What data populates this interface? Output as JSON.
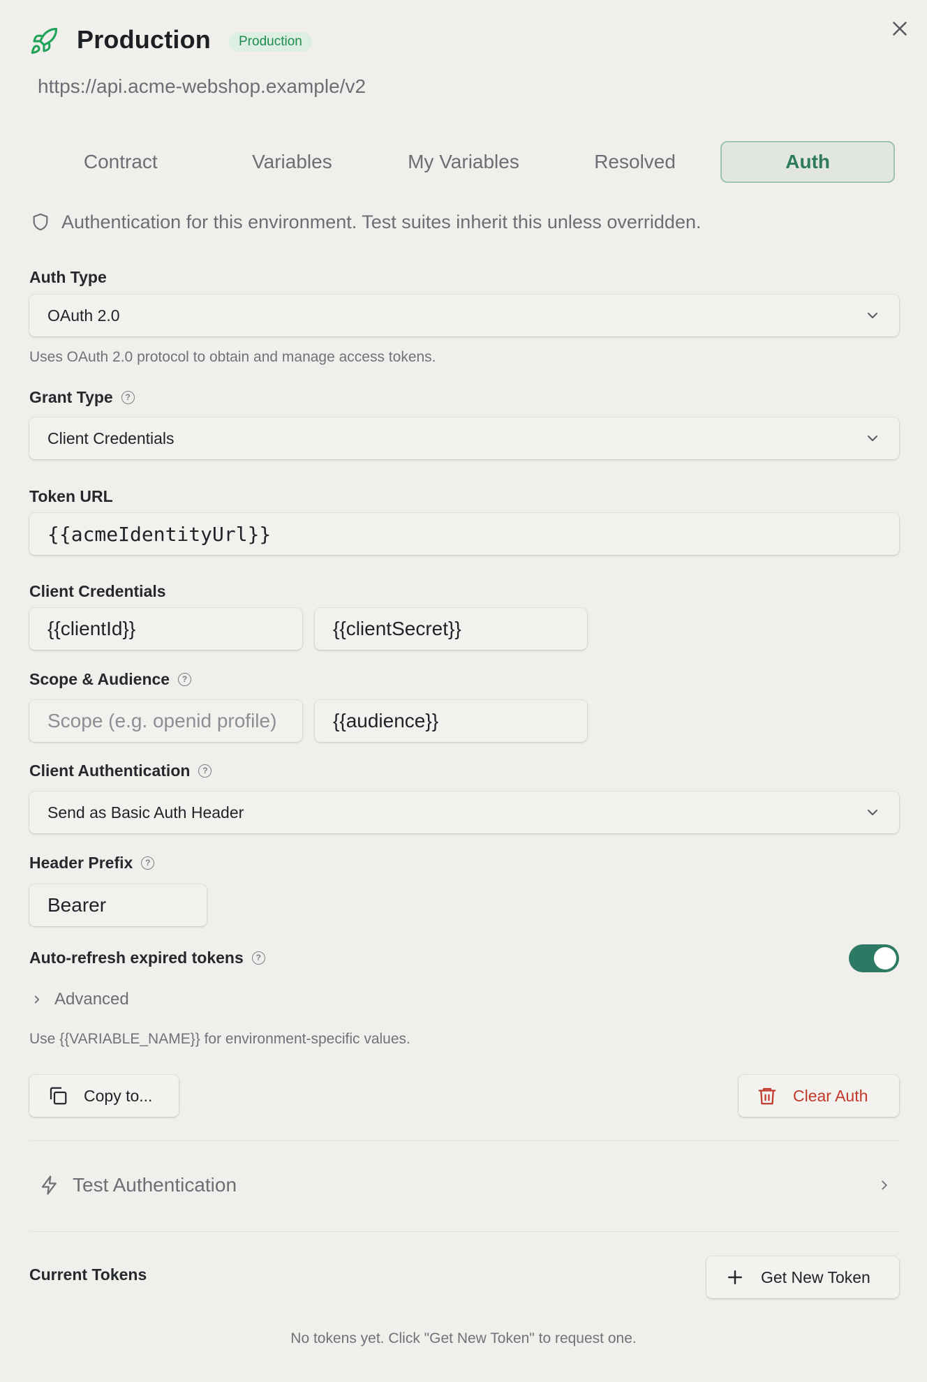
{
  "header": {
    "title": "Production",
    "badge": "Production",
    "base_url": "https://api.acme-webshop.example/v2",
    "icon": "rocket-icon",
    "accent": "#22a35a"
  },
  "tabs": [
    {
      "label": "Contract",
      "active": false
    },
    {
      "label": "Variables",
      "active": false
    },
    {
      "label": "My Variables",
      "active": false
    },
    {
      "label": "Resolved",
      "active": false
    },
    {
      "label": "Auth",
      "active": true
    }
  ],
  "info_text": "Authentication for this environment. Test suites inherit this unless overridden.",
  "auth_type": {
    "label": "Auth Type",
    "value": "OAuth 2.0",
    "hint": "Uses OAuth 2.0 protocol to obtain and manage access tokens."
  },
  "grant_type": {
    "label": "Grant Type",
    "value": "Client Credentials"
  },
  "token_url": {
    "label": "Token URL",
    "value": "{{acmeIdentityUrl}}"
  },
  "client_credentials": {
    "label": "Client Credentials",
    "client_id": "{{clientId}}",
    "client_secret": "{{clientSecret}}"
  },
  "scope_audience": {
    "label": "Scope & Audience",
    "scope_placeholder": "Scope (e.g. openid profile)",
    "audience": "{{audience}}"
  },
  "client_auth": {
    "label": "Client Authentication",
    "value": "Send as Basic Auth Header"
  },
  "header_prefix": {
    "label": "Header Prefix",
    "value": "Bearer"
  },
  "auto_refresh": {
    "label": "Auto-refresh expired tokens",
    "enabled": true,
    "color": "#2c7a63"
  },
  "advanced": {
    "label": "Advanced"
  },
  "variable_hint": "Use {{VARIABLE_NAME}} for environment-specific values.",
  "actions": {
    "copy_label": "Copy to...",
    "clear_label": "Clear Auth",
    "danger_color": "#c0392b"
  },
  "test_auth": {
    "label": "Test Authentication"
  },
  "tokens": {
    "title": "Current Tokens",
    "get_new_label": "Get New Token",
    "empty_text": "No tokens yet. Click \"Get New Token\" to request one."
  }
}
